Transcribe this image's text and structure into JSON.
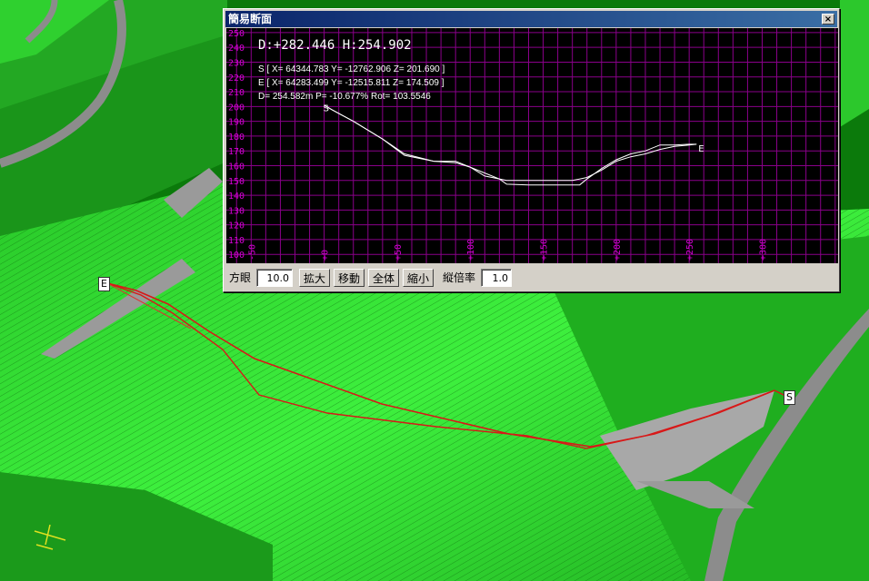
{
  "window": {
    "title": "簡易断面",
    "close_glyph": "×"
  },
  "scene": {
    "start_marker": "S",
    "end_marker": "E"
  },
  "readout": {
    "header": "D:+282.446  H:254.902",
    "start_line": "S [ X= 64344.783 Y= -12762.906 Z= 201.690 ]",
    "end_line": "E [ X= 64283.499 Y= -12515.811 Z= 174.509 ]",
    "stats_line": "D= 254.582m  P= -10.677%  Rot= 103.5546"
  },
  "toolbar": {
    "grid_label": "方眼",
    "grid_value": "10.0",
    "zoom_in": "拡大",
    "move": "移動",
    "fit_all": "全体",
    "zoom_out": "縮小",
    "vscale_label": "縦倍率",
    "vscale_value": "1.0"
  },
  "colors": {
    "grid": "#8a008a",
    "profile": "#ffffff",
    "axis_text": "#d800d8",
    "terrain_light": "#3ef03e",
    "terrain_dark": "#0b7a0b",
    "road": "#8c8c8c",
    "route_line": "#d81818"
  },
  "chart_data": {
    "type": "line",
    "y_ticks": [
      "250",
      "240",
      "230",
      "220",
      "210",
      "200",
      "190",
      "180",
      "170",
      "160",
      "150",
      "140",
      "130",
      "120",
      "110",
      "100"
    ],
    "x_ticks": [
      "-50",
      "+0",
      "+50",
      "+100",
      "+150",
      "+200",
      "+250",
      "+300"
    ],
    "xlim": [
      -67,
      352
    ],
    "ylim": [
      94,
      253
    ],
    "start_label": "S",
    "end_label": "E",
    "series": [
      {
        "x": [
          0,
          5,
          20,
          40,
          55,
          75,
          90,
          100,
          110,
          125,
          140,
          155,
          170,
          180,
          190,
          200,
          210,
          220,
          230,
          240,
          250,
          255
        ],
        "y": [
          201,
          198,
          190,
          178,
          168,
          163,
          162,
          159,
          153,
          150,
          150,
          150,
          150,
          152,
          157,
          163,
          166,
          168,
          171,
          173,
          174,
          174.5
        ]
      },
      {
        "x": [
          0,
          5,
          20,
          40,
          55,
          75,
          90,
          100,
          110,
          120,
          125,
          140,
          155,
          170,
          175,
          180,
          190,
          200,
          210,
          220,
          230,
          240,
          250,
          255
        ],
        "y": [
          201,
          198,
          190,
          178,
          167,
          163,
          163,
          159,
          155,
          151,
          147.5,
          147,
          147,
          147,
          147,
          151,
          158,
          164,
          168,
          170,
          174,
          174,
          174.5,
          174.5
        ]
      }
    ]
  }
}
